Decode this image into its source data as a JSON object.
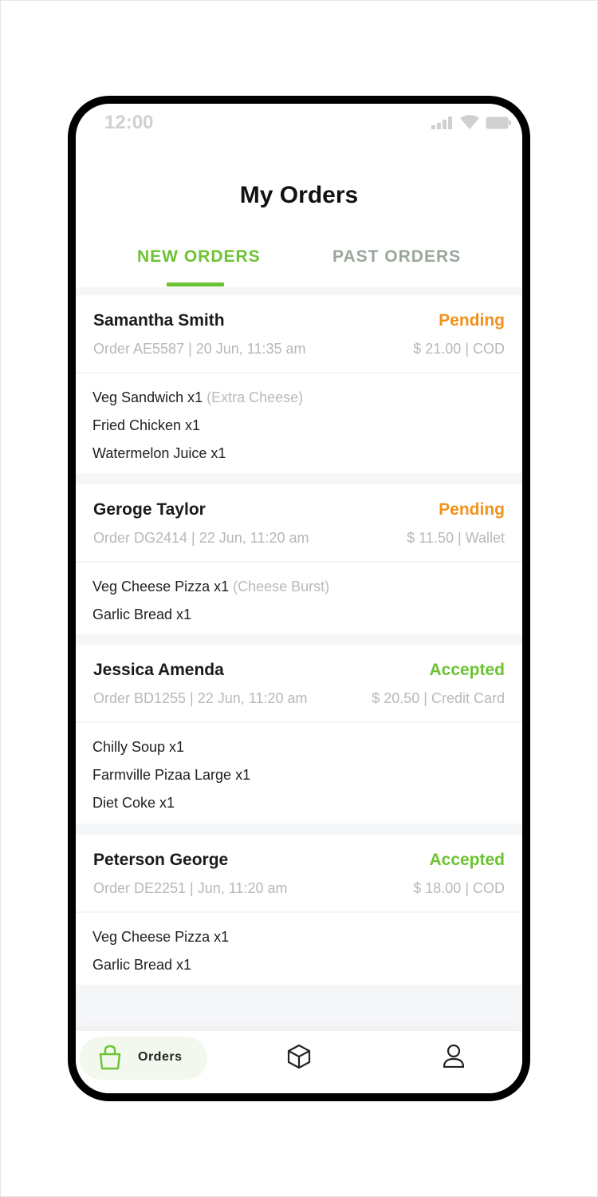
{
  "status_bar": {
    "time": "12:00"
  },
  "header": {
    "title": "My Orders"
  },
  "tabs": [
    {
      "label": "NEW ORDERS",
      "active": true
    },
    {
      "label": "PAST ORDERS",
      "active": false
    }
  ],
  "colors": {
    "accent": "#6cc332",
    "pending": "#f0921d",
    "muted": "#b8b8b8"
  },
  "orders": [
    {
      "customer": "Samantha Smith",
      "status": "Pending",
      "meta": "Order AE5587 | 20 Jun, 11:35 am",
      "payment": "$ 21.00  |  COD",
      "items": [
        {
          "text": "Veg Sandwich  x1",
          "note": " (Extra Cheese)"
        },
        {
          "text": "Fried Chicken  x1",
          "note": ""
        },
        {
          "text": "Watermelon Juice  x1",
          "note": ""
        }
      ]
    },
    {
      "customer": "Geroge Taylor",
      "status": "Pending",
      "meta": "Order DG2414 | 22 Jun, 11:20 am",
      "payment": "$ 11.50  | Wallet",
      "items": [
        {
          "text": "Veg Cheese Pizza  x1",
          "note": " (Cheese Burst)"
        },
        {
          "text": "Garlic Bread  x1",
          "note": ""
        }
      ]
    },
    {
      "customer": "Jessica Amenda",
      "status": "Accepted",
      "meta": "Order BD1255 | 22 Jun, 11:20 am",
      "payment": "$ 20.50  |  Credit Card",
      "items": [
        {
          "text": "Chilly Soup  x1",
          "note": ""
        },
        {
          "text": "Farmville Pizaa Large  x1",
          "note": ""
        },
        {
          "text": "Diet Coke  x1",
          "note": ""
        }
      ]
    },
    {
      "customer": "Peterson George",
      "status": "Accepted",
      "meta": "Order DE2251 | Jun, 11:20 am",
      "payment": "$ 18.00  |  COD",
      "items": [
        {
          "text": "Veg Cheese Pizza  x1",
          "note": ""
        },
        {
          "text": "Garlic Bread  x1",
          "note": ""
        }
      ]
    }
  ],
  "bottom_nav": [
    {
      "label": "Orders",
      "icon": "shopping-bag-icon",
      "active": true
    },
    {
      "label": "",
      "icon": "box-icon",
      "active": false
    },
    {
      "label": "",
      "icon": "profile-icon",
      "active": false
    }
  ]
}
